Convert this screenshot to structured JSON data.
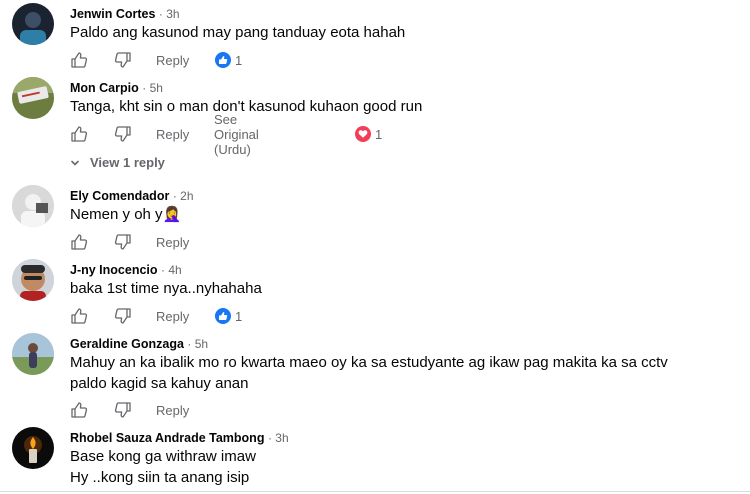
{
  "actions": {
    "reply_label": "Reply",
    "see_original_label": "See Original (Urdu)"
  },
  "comments": [
    {
      "author": "Jenwin Cortes",
      "time": "· 3h",
      "lines": [
        "Paldo ang kasunod may pang tanduay eota hahah"
      ],
      "reaction": "like",
      "reaction_count": "1",
      "reaction_color": "#1877f2"
    },
    {
      "author": "Mon Carpio",
      "time": "· 5h",
      "lines": [
        "Tanga, kht sin o man don't kasunod kuhaon good run"
      ],
      "reaction": "love",
      "reaction_count": "1",
      "reaction_color": "#f33e58",
      "see_original": true,
      "replies_label": "View 1 reply"
    },
    {
      "author": "Ely Comendador",
      "time": "· 2h",
      "lines": [
        "Nemen y oh y🤦‍♀️"
      ]
    },
    {
      "author": "J-ny Inocencio",
      "time": "· 4h",
      "lines": [
        "baka 1st time nya..nyhahaha"
      ],
      "reaction": "like",
      "reaction_count": "1",
      "reaction_color": "#1877f2"
    },
    {
      "author": "Geraldine Gonzaga",
      "time": "· 5h",
      "lines": [
        "Mahuy an ka ibalik mo ro kwarta maeo oy ka sa estudyante ag ikaw pag makita ka sa cctv",
        "paldo kagid sa kahuy anan"
      ]
    },
    {
      "author": "Rhobel Sauza Andrade Tambong",
      "time": "· 3h",
      "lines": [
        "Base kong ga withraw imaw",
        "Hy ..kong siin ta anang isip"
      ]
    }
  ]
}
